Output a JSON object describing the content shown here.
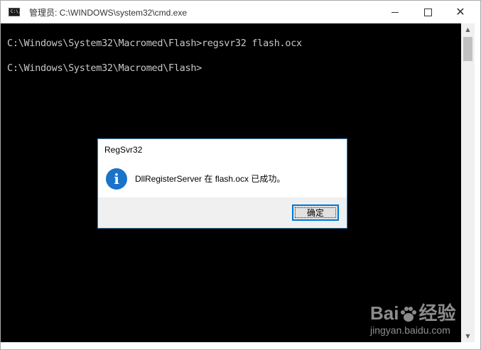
{
  "window": {
    "title": "管理员: C:\\WINDOWS\\system32\\cmd.exe",
    "icon": "cmd-icon",
    "icon_text": "C:\\."
  },
  "console": {
    "lines": [
      "C:\\Windows\\System32\\Macromed\\Flash>regsvr32 flash.ocx",
      "C:\\Windows\\System32\\Macromed\\Flash>"
    ],
    "text_color": "#c8c8c8",
    "background": "#000000"
  },
  "dialog": {
    "title": "RegSvr32",
    "icon": "info-icon",
    "message": "DllRegisterServer 在 flash.ocx 已成功。",
    "ok_label": "确定"
  },
  "watermark": {
    "logo_text_1": "Bai",
    "logo_text_2": "经验",
    "site": "jingyan.baidu.com"
  },
  "colors": {
    "dialog_border": "#3c7fb1",
    "button_focus": "#0078d7",
    "info_icon": "#1a73c8"
  }
}
